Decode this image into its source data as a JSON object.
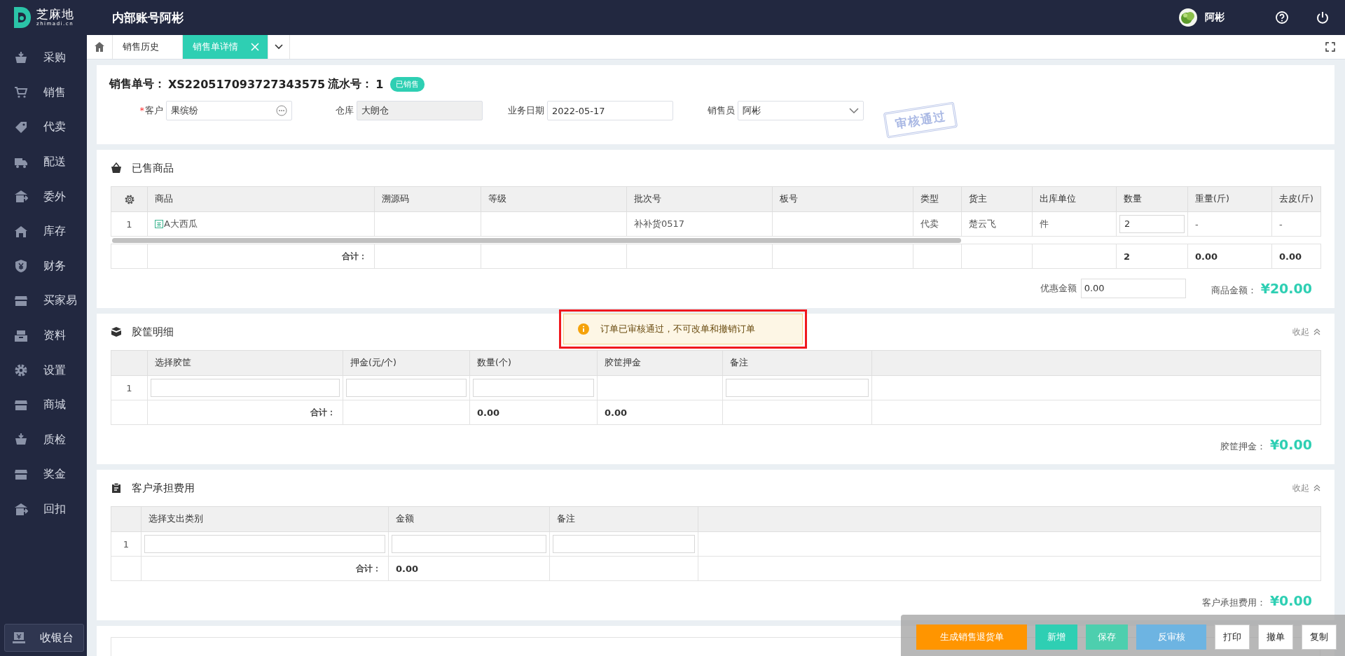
{
  "header": {
    "logo_text": "芝麻地",
    "logo_sub": "zhimadi.cn",
    "title": "内部账号阿彬",
    "user": "阿彬"
  },
  "sidebar": {
    "items": [
      {
        "label": "采购"
      },
      {
        "label": "销售"
      },
      {
        "label": "代卖"
      },
      {
        "label": "配送"
      },
      {
        "label": "委外"
      },
      {
        "label": "库存"
      },
      {
        "label": "财务"
      },
      {
        "label": "买家易"
      },
      {
        "label": "资料"
      },
      {
        "label": "设置"
      },
      {
        "label": "商城"
      },
      {
        "label": "质检"
      },
      {
        "label": "奖金"
      },
      {
        "label": "回扣"
      }
    ],
    "footer_button": "收银台"
  },
  "tabs": [
    {
      "label": "销售历史",
      "selected": false,
      "closable": false
    },
    {
      "label": "销售单详情",
      "selected": true,
      "closable": true
    }
  ],
  "order": {
    "number_label": "销售单号：",
    "number": "XS220517093727343575",
    "serial_label": "流水号：",
    "serial": "1",
    "status": "已销售",
    "stamp": "审核通过",
    "fields": [
      {
        "label": "客户",
        "value": "果缤纷",
        "kind": "picker",
        "required_mark": "*",
        "disabled": false
      },
      {
        "label": "仓库",
        "value": "大朗仓",
        "kind": "text",
        "disabled": true
      },
      {
        "label": "业务日期",
        "value": "2022-05-17",
        "kind": "text",
        "disabled": false
      },
      {
        "label": "销售员",
        "value": "阿彬",
        "kind": "dropdown",
        "disabled": false
      }
    ]
  },
  "sections": [
    {
      "title": "已售商品",
      "scrollbar": true,
      "columns": [
        {
          "kind": "settings"
        },
        {
          "label": "商品"
        },
        {
          "label": "溯源码"
        },
        {
          "label": "等级"
        },
        {
          "label": "批次号"
        },
        {
          "label": "板号"
        },
        {
          "label": "类型"
        },
        {
          "label": "货主"
        },
        {
          "label": "出库单位"
        },
        {
          "label": "数量"
        },
        {
          "label": "重量(斤)"
        },
        {
          "label": "去皮(斤)"
        }
      ],
      "rows": [
        {
          "total": false,
          "cells": [
            "1",
            {
              "kind": "product",
              "text": "A大西瓜"
            },
            null,
            null,
            "补补货0517",
            null,
            "代卖",
            "楚云飞",
            "件",
            {
              "kind": "input",
              "value": "2"
            },
            "-",
            "-"
          ]
        },
        {
          "total": true,
          "cells": [
            null,
            {
              "kind": "label",
              "text": "合计："
            },
            null,
            null,
            null,
            null,
            null,
            null,
            null,
            "2",
            "0.00",
            "0.00"
          ]
        }
      ],
      "footer": [
        {
          "kind": "field",
          "label": "优惠金额",
          "value": "0.00"
        },
        {
          "kind": "amount",
          "label": "商品金额：",
          "value": "¥20.00"
        }
      ]
    },
    {
      "title": "胶筐明细",
      "collapse": "收起",
      "scrollbar": false,
      "columns": [
        {
          "kind": "blank"
        },
        {
          "label": "选择胶筐"
        },
        {
          "label": "押金(元/个)"
        },
        {
          "label": "数量(个)"
        },
        {
          "label": "胶筐押金"
        },
        {
          "label": "备注"
        },
        {
          "kind": "blank"
        }
      ],
      "rows": [
        {
          "total": false,
          "cells": [
            "1",
            {
              "kind": "input"
            },
            {
              "kind": "input"
            },
            {
              "kind": "input"
            },
            null,
            {
              "kind": "input"
            },
            null
          ]
        },
        {
          "total": true,
          "cells": [
            null,
            {
              "kind": "label",
              "text": "合计："
            },
            null,
            "0.00",
            "0.00",
            null,
            null
          ]
        }
      ],
      "footer": [
        {
          "kind": "amount",
          "label": "胶筐押金：",
          "value": "¥0.00"
        }
      ]
    },
    {
      "title": "客户承担费用",
      "collapse": "收起",
      "scrollbar": false,
      "columns": [
        {
          "kind": "blank"
        },
        {
          "label": "选择支出类别"
        },
        {
          "label": "金额"
        },
        {
          "label": "备注"
        },
        {
          "kind": "blank"
        }
      ],
      "rows": [
        {
          "total": false,
          "cells": [
            "1",
            {
              "kind": "input"
            },
            {
              "kind": "input"
            },
            {
              "kind": "input"
            },
            null
          ]
        },
        {
          "total": true,
          "cells": [
            null,
            {
              "kind": "label",
              "text": "合计："
            },
            "0.00",
            null,
            null
          ]
        }
      ],
      "footer": [
        {
          "kind": "amount",
          "label": "客户承担费用：",
          "value": "¥0.00"
        }
      ]
    }
  ],
  "toast": {
    "text": "订单已审核通过，不可改单和撤销订单",
    "highlighted": true
  },
  "actions": [
    {
      "label": "生成销售退货单",
      "kind": "warning"
    },
    {
      "label": "新增",
      "kind": "primary"
    },
    {
      "label": "保存",
      "kind": "secondary"
    },
    {
      "label": "反审核",
      "kind": "info"
    },
    {
      "label": "打印",
      "kind": "default"
    },
    {
      "label": "撤单",
      "kind": "default"
    },
    {
      "label": "复制",
      "kind": "default"
    }
  ]
}
